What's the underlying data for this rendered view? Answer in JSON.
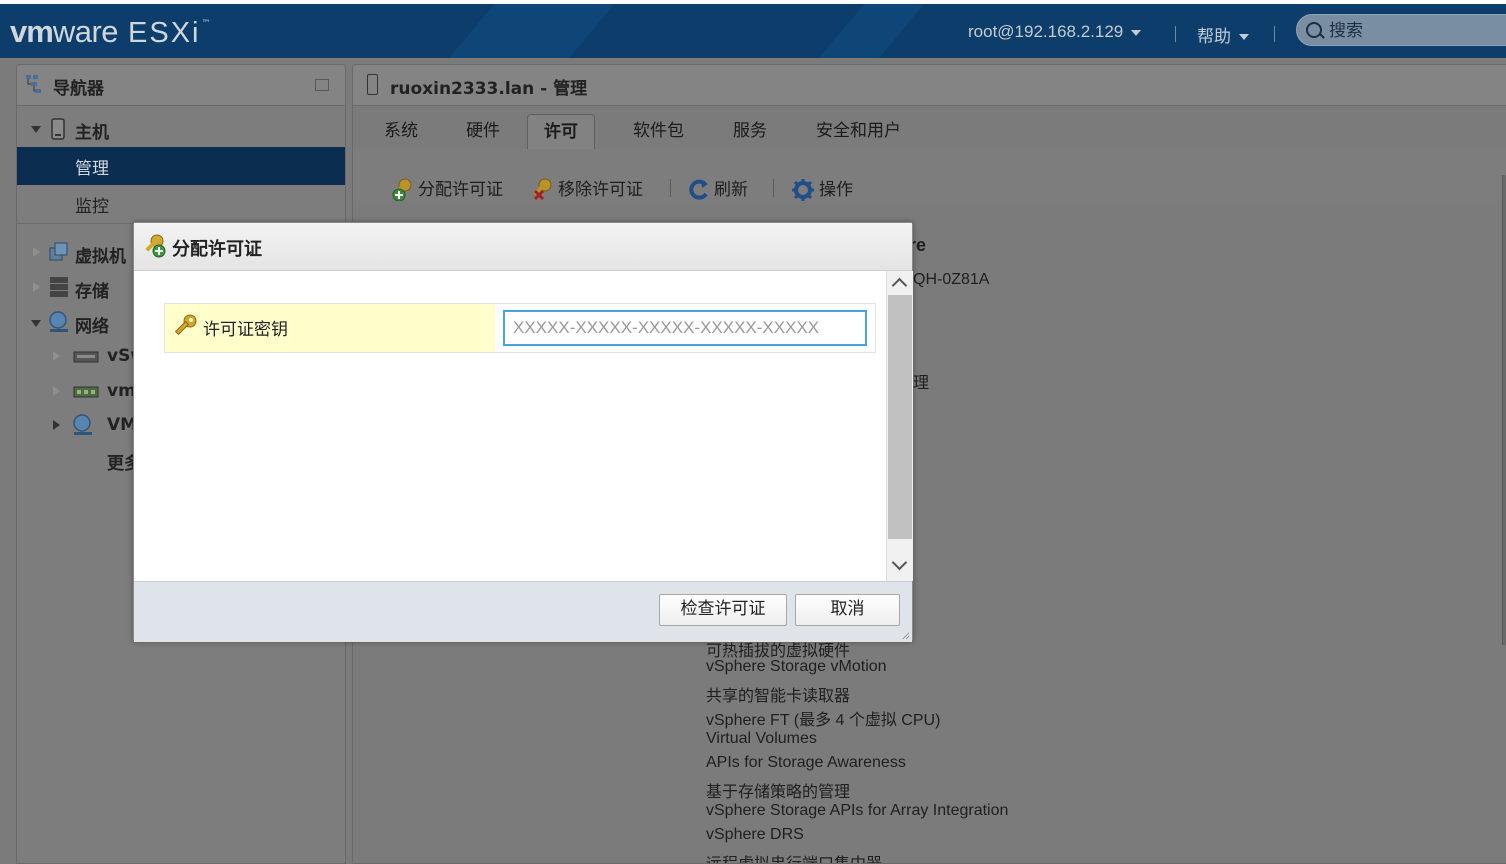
{
  "header": {
    "brand_vm": "vm",
    "brand_ware": "ware",
    "brand_product": "ESXi",
    "brand_tm": "™",
    "user": "root@192.168.2.129",
    "help": "帮助",
    "search_placeholder": "搜索"
  },
  "navigator": {
    "title": "导航器",
    "items": [
      {
        "label": "主机"
      },
      {
        "label": "管理"
      },
      {
        "label": "监控"
      },
      {
        "label": "虚拟机"
      },
      {
        "label": "存储"
      },
      {
        "label": "网络"
      },
      {
        "label": "vSw"
      },
      {
        "label": "vm"
      },
      {
        "label": "VM"
      },
      {
        "label": "更多"
      }
    ]
  },
  "main": {
    "title": "ruoxin2333.lan - 管理",
    "tabs": [
      {
        "label": "系统"
      },
      {
        "label": "硬件"
      },
      {
        "label": "许可"
      },
      {
        "label": "软件包"
      },
      {
        "label": "服务"
      },
      {
        "label": "安全和用户"
      }
    ],
    "active_tab": "许可",
    "toolbar": {
      "assign": "分配许可证",
      "remove": "移除许可证",
      "refresh": "刷新",
      "actions": "操作"
    },
    "partial_heading": "re",
    "partial_key": "QH-0Z81A",
    "partial_text": "理",
    "partial_feature": "可热插拔的虚拟硬件",
    "features": [
      "vSphere Storage vMotion",
      "共享的智能卡读取器",
      "vSphere FT (最多 4 个虚拟 CPU)",
      "Virtual Volumes",
      "APIs for Storage Awareness",
      "基于存储策略的管理",
      "vSphere Storage APIs for Array Integration",
      "vSphere DRS",
      "远程虚拟串行端口集中器"
    ]
  },
  "dialog": {
    "title": "分配许可证",
    "field_label": "许可证密钥",
    "field_placeholder": "XXXXX-XXXXX-XXXXX-XXXXX-XXXXX",
    "field_value": "",
    "check_button": "检查许可证",
    "cancel_button": "取消"
  },
  "colors": {
    "header_bg": "#0d3d6b",
    "nav_selected": "#0b2e50",
    "field_label_bg": "#ffffcc",
    "input_focus_border": "#4aa3d6",
    "dialog_footer": "#dfe4ea"
  }
}
